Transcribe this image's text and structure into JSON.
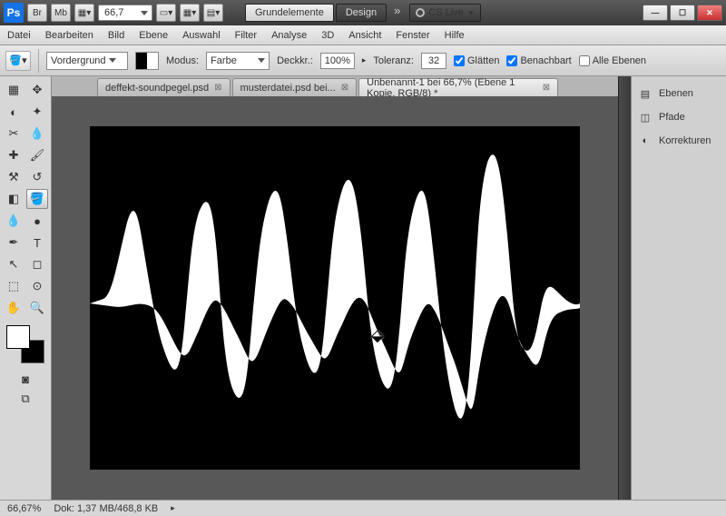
{
  "titlebar": {
    "zoom": "66,7",
    "workspaces": {
      "active": "Grundelemente",
      "other": "Design"
    },
    "cslive": "CS Live"
  },
  "menu": [
    "Datei",
    "Bearbeiten",
    "Bild",
    "Ebene",
    "Auswahl",
    "Filter",
    "Analyse",
    "3D",
    "Ansicht",
    "Fenster",
    "Hilfe"
  ],
  "opt": {
    "vordergrund": "Vordergrund",
    "modus_label": "Modus:",
    "modus_value": "Farbe",
    "deckkr_label": "Deckkr.:",
    "deckkr_value": "100%",
    "toleranz_label": "Toleranz:",
    "toleranz_value": "32",
    "glaetten": "Glätten",
    "benachbart": "Benachbart",
    "alle_ebenen": "Alle Ebenen"
  },
  "tabs": [
    {
      "label": "deffekt-soundpegel.psd",
      "active": false
    },
    {
      "label": "musterdatei.psd bei...",
      "active": false
    },
    {
      "label": "Unbenannt-1 bei 66,7% (Ebene 1 Kopie, RGB/8) *",
      "active": true
    }
  ],
  "panels": {
    "ebenen": "Ebenen",
    "pfade": "Pfade",
    "korrekturen": "Korrekturen"
  },
  "status": {
    "zoom": "66,67%",
    "dok": "Dok: 1,37 MB/468,8 KB"
  }
}
